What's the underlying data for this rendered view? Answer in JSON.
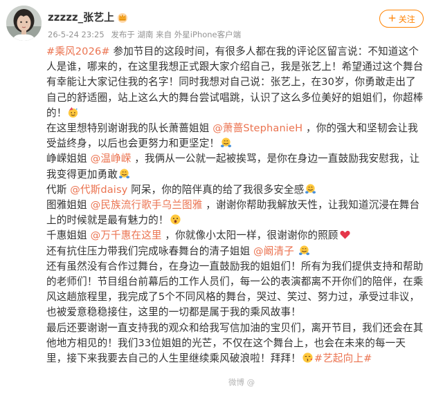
{
  "header": {
    "username": "zzzzz_张艺上",
    "timestamp": "26-5-24 23:25",
    "source": "发布于 湖南 来自 外星iPhone客户端",
    "follow_label": "关注",
    "verified_icon": "crown-icon"
  },
  "post": {
    "p1": {
      "tag": "#乘风2026#",
      "text": " 参加节目的这段时间，有很多人都在我的评论区留言说：不知道这个人是谁，哪来的，在这里我想正式跟大家介绍自己，我是张艺上！希望通过这个舞台有幸能让大家记住我的名字！同时我想对自己说：张艺上，在30岁，你勇敢走出了自己的舒适圈，站上这么大的舞台尝试唱跳，认识了这么多位美好的姐姐们，你超棒的！"
    },
    "p2": {
      "text": "在这里想特别谢谢我的队长萧蔷姐姐 ",
      "mention": "@萧蔷StephanieH",
      "text2": " ，你的强大和坚韧会让我受益终身，以后也会更努力和更坚定！"
    },
    "p3": {
      "text": "峥嵘姐姐 ",
      "mention": "@温峥嵘",
      "text2": " ，我俩从一公就一起被挨骂，是你在身边一直鼓励我安慰我，让我变得更加勇敢"
    },
    "p4": {
      "text": "代斯 ",
      "mention": "@代斯daisy",
      "text2": " 阿呆，你的陪伴真的给了我很多安全感"
    },
    "p5": {
      "text": "图雅姐姐 ",
      "mention": "@民族流行歌手乌兰图雅",
      "text2": " ，谢谢你帮助我解放天性，让我知道沉浸在舞台上的时候就是最有魅力的！"
    },
    "p6": {
      "text": "千惠姐姐 ",
      "mention": "@万千惠在这里",
      "text2": " ，你就像小太阳一样，很谢谢你的照顾"
    },
    "p7": {
      "text": "还有抗住压力带我们完成咏春舞台的清子姐姐 ",
      "mention": "@阚清子",
      "text2": " "
    },
    "p8": {
      "text": "还有虽然没有合作过舞台，在身边一直鼓励我的姐姐们！所有为我们提供支持和帮助的老师们！节目组台前幕后的工作人员们，每一公的表演都离不开你们的陪伴，在乘风这趟旅程里，我完成了5个不同风格的舞台，哭过、笑过、努力过，承受过非议，也被爱意稳稳接住，这里的一切都是属于我的乘风故事！"
    },
    "p9": {
      "text": "最后还要谢谢一直支持我的观众和给我写信加油的宝贝们，离开节目，我们还会在其他地方相见的！我们33位姐姐的光芒，不仅在这个舞台上，也会在未来的每一天里，接下来我要去自己的人生里继续乘风破浪啦！拜拜！",
      "tag": "#艺起向上#"
    }
  },
  "watermark": "微博 @"
}
